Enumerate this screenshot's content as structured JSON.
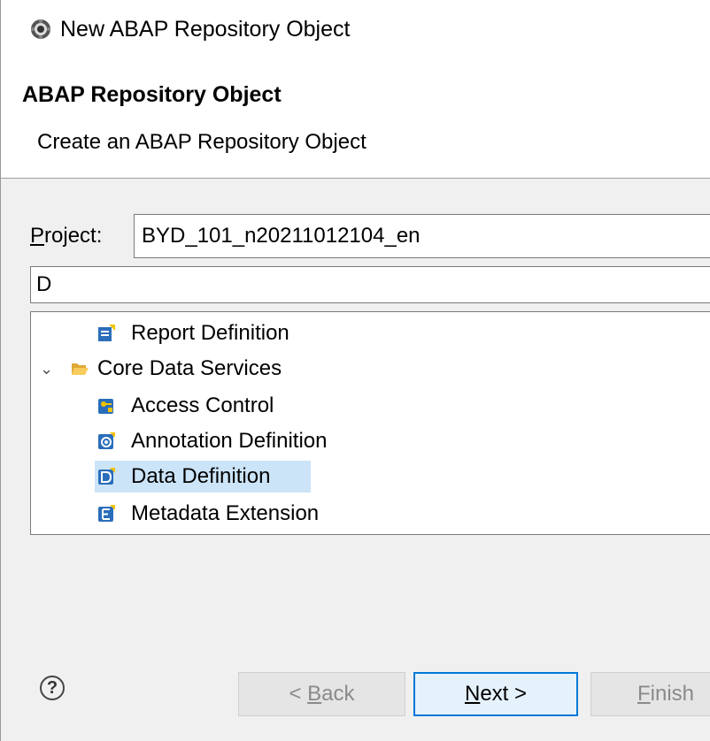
{
  "window": {
    "title": "New ABAP Repository Object",
    "icon": "eclipse-gear-icon"
  },
  "header": {
    "title": "ABAP Repository Object",
    "subtitle": "Create an ABAP Repository Object"
  },
  "form": {
    "project_label_mnemonic": "P",
    "project_label_rest": "roject:",
    "project_value": "BYD_101_n20211012104_en",
    "filter_value": "D"
  },
  "tree": {
    "items": [
      {
        "label": "Report Definition",
        "icon": "report-definition-icon",
        "level": 1,
        "selected": false
      },
      {
        "label": "Core Data Services",
        "icon": "folder-open-icon",
        "level": 0,
        "expanded": true,
        "selected": false
      },
      {
        "label": "Access Control",
        "icon": "access-control-icon",
        "level": 1,
        "selected": false
      },
      {
        "label": "Annotation Definition",
        "icon": "annotation-definition-icon",
        "level": 1,
        "selected": false
      },
      {
        "label": "Data Definition",
        "icon": "data-definition-icon",
        "level": 1,
        "selected": true
      },
      {
        "label": "Metadata Extension",
        "icon": "metadata-extension-icon",
        "level": 1,
        "selected": false
      }
    ]
  },
  "buttons": {
    "help_symbol": "?",
    "back_prefix": "< ",
    "back_mnemonic": "B",
    "back_rest": "ack",
    "next_mnemonic": "N",
    "next_rest": "ext >",
    "finish_mnemonic": "F",
    "finish_rest": "inish"
  },
  "colors": {
    "selection": "#cce4f7",
    "default_button_border": "#0078d7",
    "panel_bg": "#f0f0f0"
  }
}
